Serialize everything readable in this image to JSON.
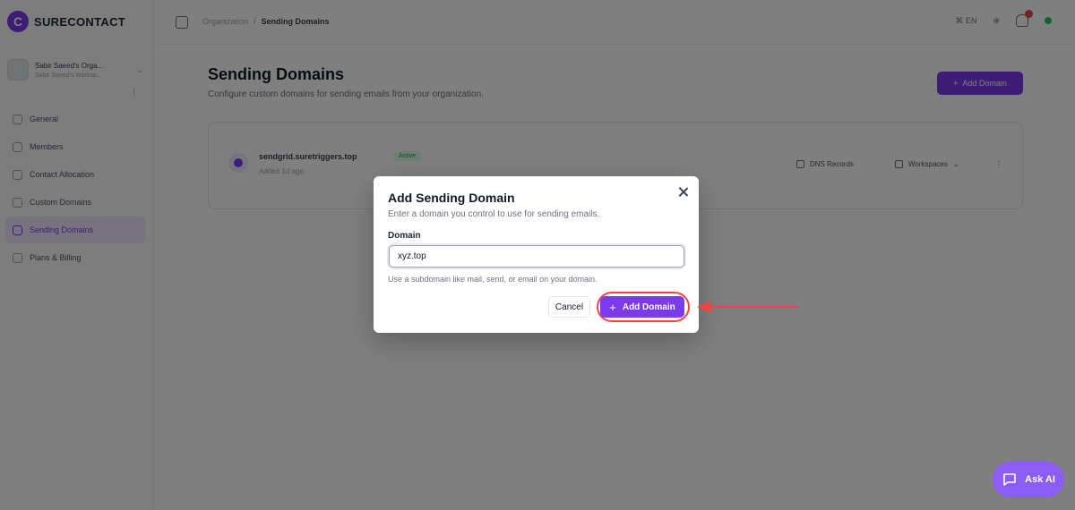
{
  "app": {
    "brand": "SURECONTACT",
    "logo_letter": "C"
  },
  "org": {
    "name": "Sabir Saeed's Orga...",
    "subtitle": "Sabir Saeed's Worksp..."
  },
  "sidebar": {
    "items": [
      {
        "label": "General",
        "icon": "gear-icon",
        "active": false
      },
      {
        "label": "Members",
        "icon": "users-icon",
        "active": false
      },
      {
        "label": "Contact Allocation",
        "icon": "contact-icon",
        "active": false
      },
      {
        "label": "Custom Domains",
        "icon": "globe-icon",
        "active": false
      },
      {
        "label": "Sending Domains",
        "icon": "mail-icon",
        "active": true
      },
      {
        "label": "Plans & Billing",
        "icon": "credit-card-icon",
        "active": false
      }
    ]
  },
  "topbar": {
    "breadcrumb_root": "Organization",
    "breadcrumb_sep": "/",
    "breadcrumb_current": "Sending Domains",
    "language": "EN"
  },
  "page": {
    "title": "Sending Domains",
    "subtitle": "Configure custom domains for sending emails from your organization.",
    "add_button": "Add Domain"
  },
  "domain_card": {
    "name": "sendgrid.suretriggers.top",
    "badge": "Active",
    "meta": "Added 1d ago",
    "dns_label": "DNS Records",
    "workspace_label": "Workspaces"
  },
  "modal": {
    "title": "Add Sending Domain",
    "description": "Enter a domain you control to use for sending emails.",
    "field_label": "Domain",
    "input_value": "xyz.top",
    "help_text": "Use a subdomain like mail, send, or email on your domain.",
    "cancel_label": "Cancel",
    "submit_label": "Add Domain"
  },
  "ask_ai": {
    "label": "Ask AI"
  },
  "colors": {
    "accent": "#7c3aed",
    "annotation": "#ef4444"
  }
}
